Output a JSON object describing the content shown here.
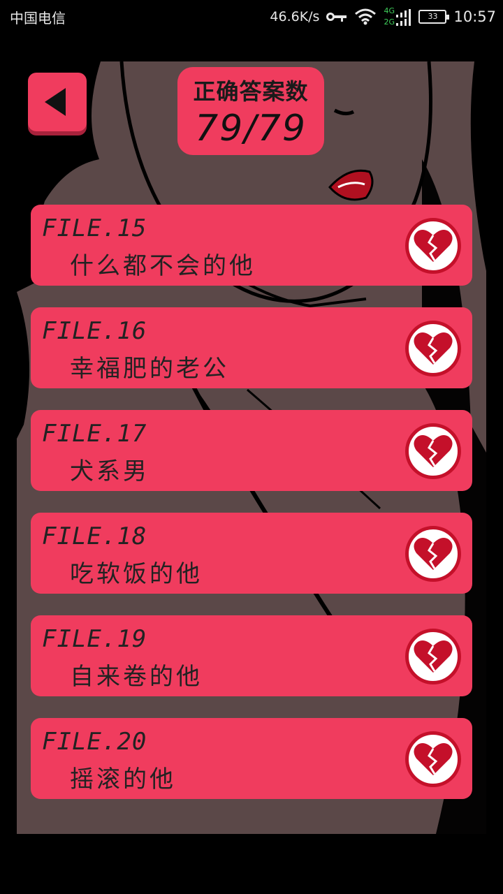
{
  "status_bar": {
    "carrier": "中国电信",
    "speed": "46.6K/s",
    "net_top": "4G",
    "net_bottom": "2G",
    "battery": "33",
    "time": "10:57"
  },
  "header": {
    "score_title": "正确答案数",
    "score_value": "79/79"
  },
  "files": [
    {
      "number": "FILE.15",
      "title": "什么都不会的他",
      "icon": "broken-heart-icon"
    },
    {
      "number": "FILE.16",
      "title": "幸福肥的老公",
      "icon": "broken-heart-icon"
    },
    {
      "number": "FILE.17",
      "title": "犬系男",
      "icon": "broken-heart-icon"
    },
    {
      "number": "FILE.18",
      "title": "吃软饭的他",
      "icon": "broken-heart-icon"
    },
    {
      "number": "FILE.19",
      "title": "自来卷的他",
      "icon": "broken-heart-icon"
    },
    {
      "number": "FILE.20",
      "title": "摇滚的他",
      "icon": "broken-heart-icon"
    }
  ],
  "colors": {
    "accent": "#f03c5e",
    "heart": "#c4102a",
    "art_background": "#5b4848"
  }
}
